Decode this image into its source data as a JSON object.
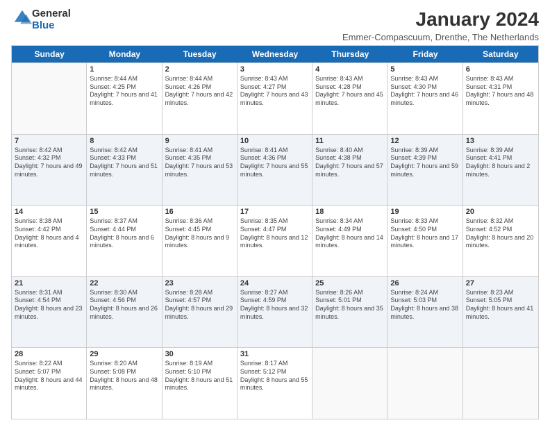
{
  "header": {
    "logo_general": "General",
    "logo_blue": "Blue",
    "title": "January 2024",
    "location": "Emmer-Compascuum, Drenthe, The Netherlands"
  },
  "days_of_week": [
    "Sunday",
    "Monday",
    "Tuesday",
    "Wednesday",
    "Thursday",
    "Friday",
    "Saturday"
  ],
  "weeks": [
    [
      {
        "day": "",
        "empty": true
      },
      {
        "day": "1",
        "sunrise": "Sunrise: 8:44 AM",
        "sunset": "Sunset: 4:25 PM",
        "daylight": "Daylight: 7 hours and 41 minutes."
      },
      {
        "day": "2",
        "sunrise": "Sunrise: 8:44 AM",
        "sunset": "Sunset: 4:26 PM",
        "daylight": "Daylight: 7 hours and 42 minutes."
      },
      {
        "day": "3",
        "sunrise": "Sunrise: 8:43 AM",
        "sunset": "Sunset: 4:27 PM",
        "daylight": "Daylight: 7 hours and 43 minutes."
      },
      {
        "day": "4",
        "sunrise": "Sunrise: 8:43 AM",
        "sunset": "Sunset: 4:28 PM",
        "daylight": "Daylight: 7 hours and 45 minutes."
      },
      {
        "day": "5",
        "sunrise": "Sunrise: 8:43 AM",
        "sunset": "Sunset: 4:30 PM",
        "daylight": "Daylight: 7 hours and 46 minutes."
      },
      {
        "day": "6",
        "sunrise": "Sunrise: 8:43 AM",
        "sunset": "Sunset: 4:31 PM",
        "daylight": "Daylight: 7 hours and 48 minutes."
      }
    ],
    [
      {
        "day": "7",
        "sunrise": "Sunrise: 8:42 AM",
        "sunset": "Sunset: 4:32 PM",
        "daylight": "Daylight: 7 hours and 49 minutes."
      },
      {
        "day": "8",
        "sunrise": "Sunrise: 8:42 AM",
        "sunset": "Sunset: 4:33 PM",
        "daylight": "Daylight: 7 hours and 51 minutes."
      },
      {
        "day": "9",
        "sunrise": "Sunrise: 8:41 AM",
        "sunset": "Sunset: 4:35 PM",
        "daylight": "Daylight: 7 hours and 53 minutes."
      },
      {
        "day": "10",
        "sunrise": "Sunrise: 8:41 AM",
        "sunset": "Sunset: 4:36 PM",
        "daylight": "Daylight: 7 hours and 55 minutes."
      },
      {
        "day": "11",
        "sunrise": "Sunrise: 8:40 AM",
        "sunset": "Sunset: 4:38 PM",
        "daylight": "Daylight: 7 hours and 57 minutes."
      },
      {
        "day": "12",
        "sunrise": "Sunrise: 8:39 AM",
        "sunset": "Sunset: 4:39 PM",
        "daylight": "Daylight: 7 hours and 59 minutes."
      },
      {
        "day": "13",
        "sunrise": "Sunrise: 8:39 AM",
        "sunset": "Sunset: 4:41 PM",
        "daylight": "Daylight: 8 hours and 2 minutes."
      }
    ],
    [
      {
        "day": "14",
        "sunrise": "Sunrise: 8:38 AM",
        "sunset": "Sunset: 4:42 PM",
        "daylight": "Daylight: 8 hours and 4 minutes."
      },
      {
        "day": "15",
        "sunrise": "Sunrise: 8:37 AM",
        "sunset": "Sunset: 4:44 PM",
        "daylight": "Daylight: 8 hours and 6 minutes."
      },
      {
        "day": "16",
        "sunrise": "Sunrise: 8:36 AM",
        "sunset": "Sunset: 4:45 PM",
        "daylight": "Daylight: 8 hours and 9 minutes."
      },
      {
        "day": "17",
        "sunrise": "Sunrise: 8:35 AM",
        "sunset": "Sunset: 4:47 PM",
        "daylight": "Daylight: 8 hours and 12 minutes."
      },
      {
        "day": "18",
        "sunrise": "Sunrise: 8:34 AM",
        "sunset": "Sunset: 4:49 PM",
        "daylight": "Daylight: 8 hours and 14 minutes."
      },
      {
        "day": "19",
        "sunrise": "Sunrise: 8:33 AM",
        "sunset": "Sunset: 4:50 PM",
        "daylight": "Daylight: 8 hours and 17 minutes."
      },
      {
        "day": "20",
        "sunrise": "Sunrise: 8:32 AM",
        "sunset": "Sunset: 4:52 PM",
        "daylight": "Daylight: 8 hours and 20 minutes."
      }
    ],
    [
      {
        "day": "21",
        "sunrise": "Sunrise: 8:31 AM",
        "sunset": "Sunset: 4:54 PM",
        "daylight": "Daylight: 8 hours and 23 minutes."
      },
      {
        "day": "22",
        "sunrise": "Sunrise: 8:30 AM",
        "sunset": "Sunset: 4:56 PM",
        "daylight": "Daylight: 8 hours and 26 minutes."
      },
      {
        "day": "23",
        "sunrise": "Sunrise: 8:28 AM",
        "sunset": "Sunset: 4:57 PM",
        "daylight": "Daylight: 8 hours and 29 minutes."
      },
      {
        "day": "24",
        "sunrise": "Sunrise: 8:27 AM",
        "sunset": "Sunset: 4:59 PM",
        "daylight": "Daylight: 8 hours and 32 minutes."
      },
      {
        "day": "25",
        "sunrise": "Sunrise: 8:26 AM",
        "sunset": "Sunset: 5:01 PM",
        "daylight": "Daylight: 8 hours and 35 minutes."
      },
      {
        "day": "26",
        "sunrise": "Sunrise: 8:24 AM",
        "sunset": "Sunset: 5:03 PM",
        "daylight": "Daylight: 8 hours and 38 minutes."
      },
      {
        "day": "27",
        "sunrise": "Sunrise: 8:23 AM",
        "sunset": "Sunset: 5:05 PM",
        "daylight": "Daylight: 8 hours and 41 minutes."
      }
    ],
    [
      {
        "day": "28",
        "sunrise": "Sunrise: 8:22 AM",
        "sunset": "Sunset: 5:07 PM",
        "daylight": "Daylight: 8 hours and 44 minutes."
      },
      {
        "day": "29",
        "sunrise": "Sunrise: 8:20 AM",
        "sunset": "Sunset: 5:08 PM",
        "daylight": "Daylight: 8 hours and 48 minutes."
      },
      {
        "day": "30",
        "sunrise": "Sunrise: 8:19 AM",
        "sunset": "Sunset: 5:10 PM",
        "daylight": "Daylight: 8 hours and 51 minutes."
      },
      {
        "day": "31",
        "sunrise": "Sunrise: 8:17 AM",
        "sunset": "Sunset: 5:12 PM",
        "daylight": "Daylight: 8 hours and 55 minutes."
      },
      {
        "day": "",
        "empty": true
      },
      {
        "day": "",
        "empty": true
      },
      {
        "day": "",
        "empty": true
      }
    ]
  ]
}
